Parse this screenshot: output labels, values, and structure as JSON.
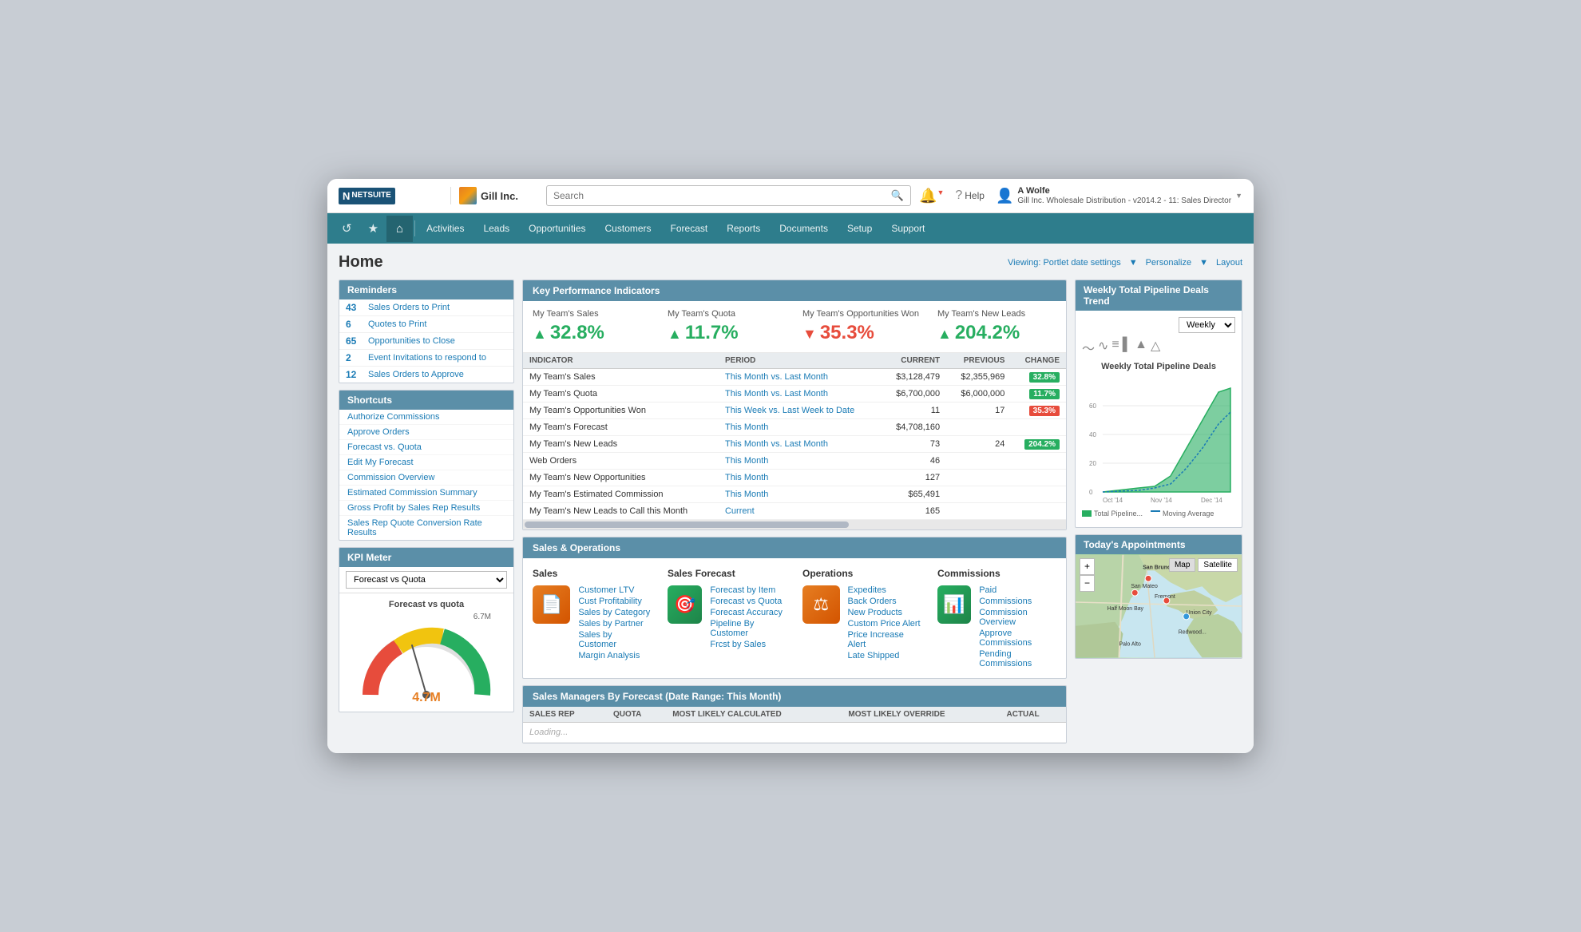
{
  "browser": {
    "company": "Gill Inc.",
    "search_placeholder": "Search"
  },
  "topbar": {
    "logo": "N NETSUITE",
    "company_name": "Gill Inc.",
    "help_label": "Help",
    "user_name": "A Wolfe",
    "user_subtitle": "Gill Inc. Wholesale Distribution - v2014.2 - 11: Sales Director"
  },
  "nav": {
    "items": [
      "Activities",
      "Leads",
      "Opportunities",
      "Customers",
      "Forecast",
      "Reports",
      "Documents",
      "Setup",
      "Support"
    ]
  },
  "page": {
    "title": "Home",
    "viewing_label": "Viewing: Portlet date settings",
    "personalize_label": "Personalize",
    "layout_label": "Layout"
  },
  "reminders": {
    "title": "Reminders",
    "items": [
      {
        "count": "43",
        "label": "Sales Orders to Print"
      },
      {
        "count": "6",
        "label": "Quotes to Print"
      },
      {
        "count": "65",
        "label": "Opportunities to Close"
      },
      {
        "count": "2",
        "label": "Event Invitations to respond to"
      },
      {
        "count": "12",
        "label": "Sales Orders to Approve"
      }
    ]
  },
  "shortcuts": {
    "title": "Shortcuts",
    "items": [
      "Authorize Commissions",
      "Approve Orders",
      "Forecast vs. Quota",
      "Edit My Forecast",
      "Commission Overview",
      "Estimated Commission Summary",
      "Gross Profit by Sales Rep Results",
      "Sales Rep Quote Conversion Rate Results"
    ]
  },
  "kpi_meter": {
    "title": "KPI Meter",
    "select_options": [
      "Forecast vs Quota"
    ],
    "selected": "Forecast vs Quota",
    "gauge_label": "Forecast vs quota",
    "gauge_max": "6.7M",
    "gauge_value": "4.7M"
  },
  "kpi_section": {
    "title": "Key Performance Indicators",
    "metrics": [
      {
        "label": "My Team's Sales",
        "value": "32.8%",
        "direction": "up"
      },
      {
        "label": "My Team's Quota",
        "value": "11.7%",
        "direction": "up"
      },
      {
        "label": "My Team's Opportunities Won",
        "value": "35.3%",
        "direction": "down"
      },
      {
        "label": "My Team's New Leads",
        "value": "204.2%",
        "direction": "up"
      }
    ],
    "table_headers": [
      "Indicator",
      "Period",
      "Current",
      "Previous",
      "Change"
    ],
    "table_rows": [
      {
        "indicator": "My Team's Sales",
        "period": "This Month vs. Last Month",
        "current": "$3,128,479",
        "previous": "$2,355,969",
        "change": "32.8%",
        "direction": "up"
      },
      {
        "indicator": "My Team's Quota",
        "period": "This Month vs. Last Month",
        "current": "$6,700,000",
        "previous": "$6,000,000",
        "change": "11.7%",
        "direction": "up"
      },
      {
        "indicator": "My Team's Opportunities Won",
        "period": "This Week vs. Last Week to Date",
        "current": "11",
        "previous": "17",
        "change": "35.3%",
        "direction": "down"
      },
      {
        "indicator": "My Team's Forecast",
        "period": "This Month",
        "current": "$4,708,160",
        "previous": "",
        "change": "",
        "direction": ""
      },
      {
        "indicator": "My Team's New Leads",
        "period": "This Month vs. Last Month",
        "current": "73",
        "previous": "24",
        "change": "204.2%",
        "direction": "up"
      },
      {
        "indicator": "Web Orders",
        "period": "This Month",
        "current": "46",
        "previous": "",
        "change": "",
        "direction": ""
      },
      {
        "indicator": "My Team's New Opportunities",
        "period": "This Month",
        "current": "127",
        "previous": "",
        "change": "",
        "direction": ""
      },
      {
        "indicator": "My Team's Estimated Commission",
        "period": "This Month",
        "current": "$65,491",
        "previous": "",
        "change": "",
        "direction": ""
      },
      {
        "indicator": "My Team's New Leads to Call this Month",
        "period": "Current",
        "current": "165",
        "previous": "",
        "change": "",
        "direction": ""
      }
    ]
  },
  "sales_ops": {
    "title": "Sales & Operations",
    "columns": {
      "sales": {
        "title": "Sales",
        "icon_type": "orange",
        "icon_symbol": "doc",
        "links": [
          "Customer LTV",
          "Cust Profitability",
          "Sales by Category",
          "Sales by Partner",
          "Sales by Customer",
          "Margin Analysis"
        ]
      },
      "sales_forecast": {
        "title": "Sales Forecast",
        "icon_type": "green",
        "icon_symbol": "target",
        "links": [
          "Forecast by Item",
          "Forecast vs Quota",
          "Forecast Accuracy",
          "Pipeline By Customer",
          "Frcst by Sales"
        ]
      },
      "operations": {
        "title": "Operations",
        "icon_type": "orange",
        "icon_symbol": "scale",
        "links": [
          "Expedites",
          "Back Orders",
          "New Products",
          "Custom Price Alert",
          "Price Increase Alert",
          "Late Shipped"
        ]
      },
      "commissions": {
        "title": "Commissions",
        "icon_type": "green",
        "icon_symbol": "chart",
        "links": [
          "Paid",
          "Commissions",
          "Commission Overview",
          "Approve Commissions",
          "Pending Commissions"
        ]
      }
    }
  },
  "sales_managers": {
    "title": "Sales Managers By Forecast (Date Range: This Month)",
    "headers": [
      "SALES REP",
      "QUOTA",
      "MOST LIKELY CALCULATED",
      "MOST LIKELY OVERRIDE",
      "ACTUAL"
    ]
  },
  "chart": {
    "title": "Weekly Total Pipeline Deals Trend",
    "select_label": "Weekly",
    "chart_title": "Weekly Total Pipeline Deals",
    "x_labels": [
      "Oct '14",
      "Nov '14",
      "Dec '14"
    ],
    "y_labels": [
      "0",
      "20",
      "40",
      "60"
    ],
    "legend": [
      {
        "label": "Total Pipeline...",
        "color": "#27ae60"
      },
      {
        "label": "Moving Average",
        "color": "#1a7bb5",
        "dashed": true
      }
    ]
  },
  "appointments": {
    "title": "Today's Appointments",
    "map_btn1": "Map",
    "map_btn2": "Satellite"
  }
}
